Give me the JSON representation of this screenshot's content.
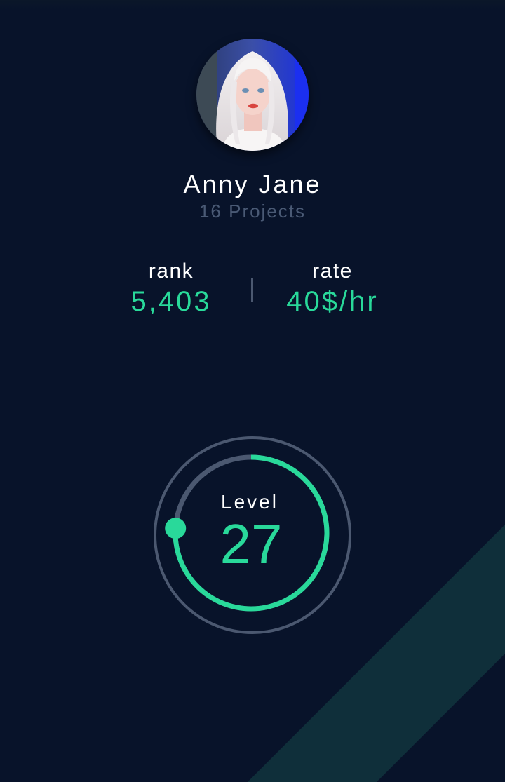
{
  "profile": {
    "name": "Anny Jane",
    "projects": "16 Projects"
  },
  "stats": {
    "rank_label": "rank",
    "rank_value": "5,403",
    "rate_label": "rate",
    "rate_value": "40$/hr"
  },
  "level": {
    "label": "Level",
    "value": "27",
    "progress_fraction": 0.76
  },
  "colors": {
    "background": "#08132a",
    "accent": "#29d99a",
    "muted_text": "#4a5a75",
    "ring_track": "#4b5870",
    "stripe": "#0f2f3a"
  }
}
